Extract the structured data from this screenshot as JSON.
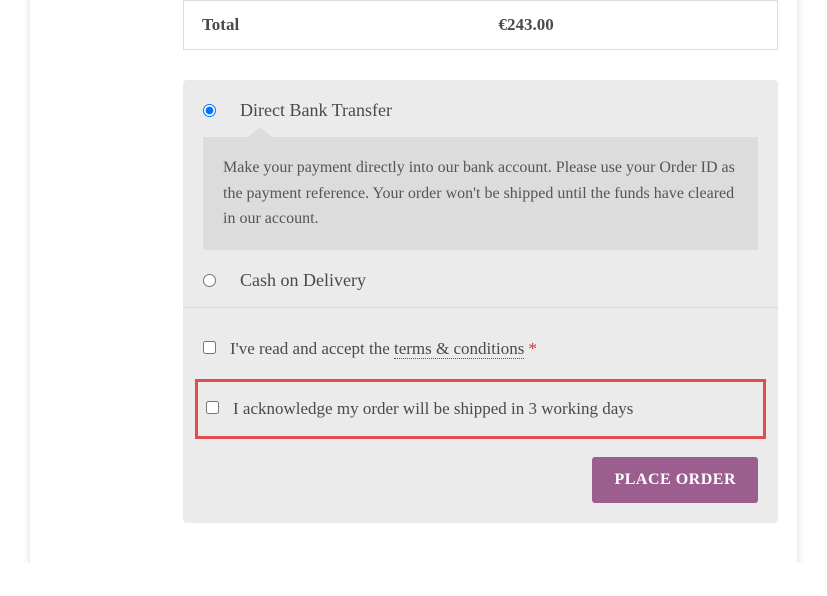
{
  "order": {
    "total_label": "Total",
    "total_value": "€243.00"
  },
  "payment": {
    "methods": [
      {
        "id": "bank",
        "label": "Direct Bank Transfer",
        "selected": true,
        "description": "Make your payment directly into our bank account. Please use your Order ID as the payment reference. Your order won't be shipped until the funds have cleared in our account."
      },
      {
        "id": "cod",
        "label": "Cash on Delivery",
        "selected": false,
        "description": ""
      }
    ]
  },
  "terms": {
    "prefix": "I've read and accept the ",
    "link_text": "terms & conditions",
    "required_mark": "*"
  },
  "acknowledge": {
    "text": "I acknowledge my order will be shipped in 3 working days"
  },
  "buttons": {
    "place_order": "PLACE ORDER"
  }
}
